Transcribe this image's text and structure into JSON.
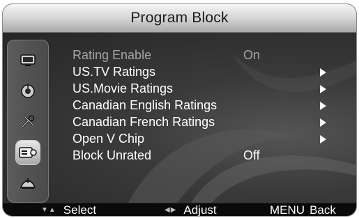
{
  "header": {
    "title": "Program Block"
  },
  "sidebar": {
    "icons": [
      {
        "name": "picture-icon"
      },
      {
        "name": "sound-icon"
      },
      {
        "name": "setup-icon"
      },
      {
        "name": "lock-icon",
        "selected": true
      },
      {
        "name": "channel-icon"
      }
    ]
  },
  "menu": {
    "items": [
      {
        "label": "Rating Enable",
        "value": "On",
        "disabled": true
      },
      {
        "label": "US.TV Ratings",
        "value": "",
        "submenu": true
      },
      {
        "label": "US.Movie Ratings",
        "value": "",
        "submenu": true
      },
      {
        "label": "Canadian English Ratings",
        "value": "",
        "submenu": true
      },
      {
        "label": "Canadian French Ratings",
        "value": "",
        "submenu": true
      },
      {
        "label": "Open V Chip",
        "value": "",
        "submenu": true
      },
      {
        "label": "Block Unrated",
        "value": "Off"
      }
    ]
  },
  "footer": {
    "select_label": "Select",
    "adjust_label": "Adjust",
    "menu_key": "MENU",
    "back_label": "Back"
  },
  "colors": {
    "title_bar": "#d9d9d9",
    "panel": "#2b2b2b",
    "text": "#ffffff",
    "disabled_text": "#a5a5a5"
  }
}
